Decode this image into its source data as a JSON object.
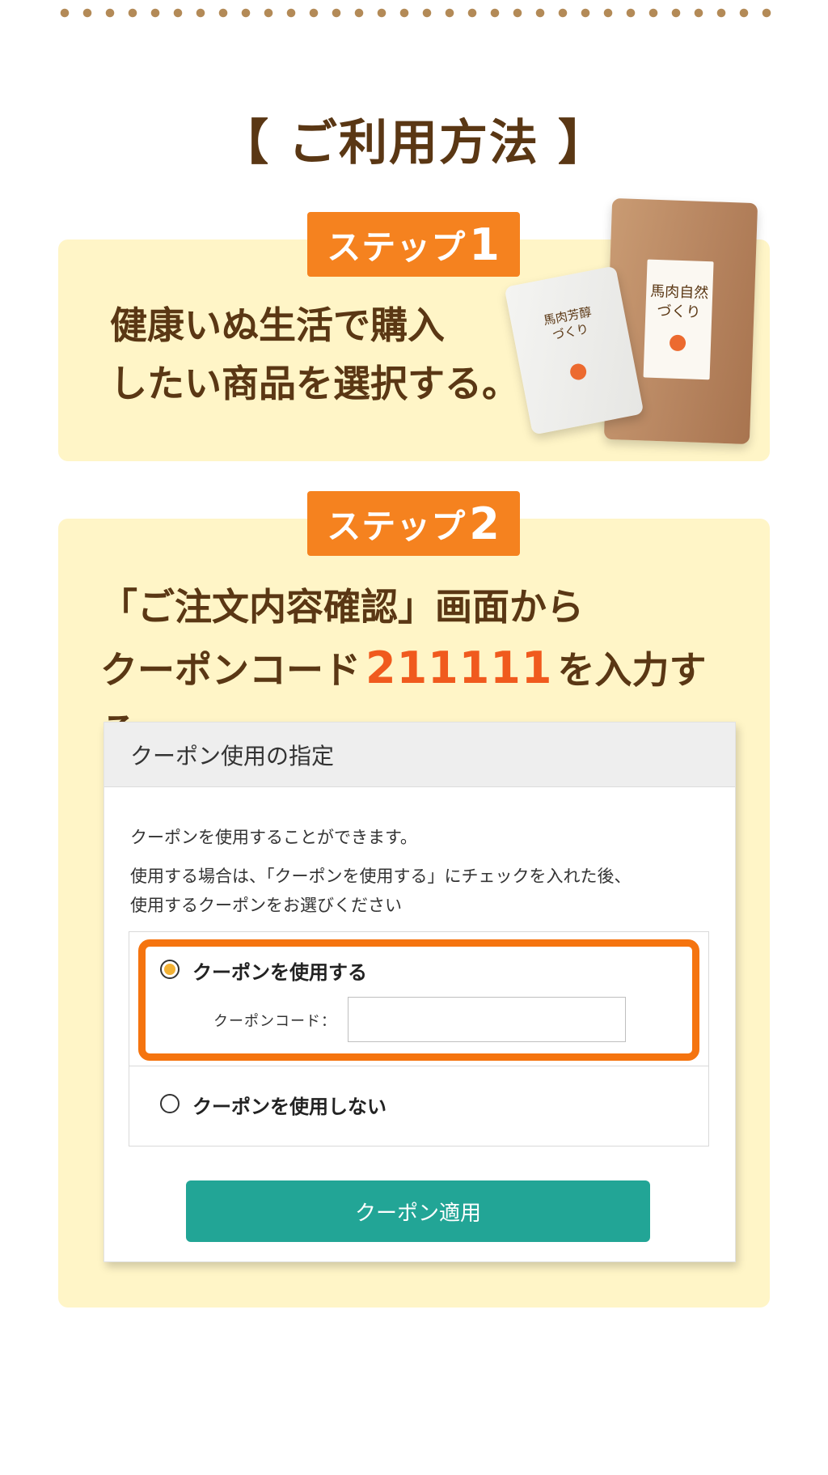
{
  "page": {
    "title": "【 ご利用方法 】"
  },
  "step1": {
    "badge_text": "ステップ",
    "badge_num": "1",
    "line1": "健康いぬ生活で購入",
    "line2": "したい商品を選択する。",
    "products": [
      {
        "title_line1": "馬肉自然",
        "title_line2": "づくり"
      },
      {
        "title_line1": "馬肉芳醇",
        "title_line2": "づくり"
      }
    ]
  },
  "step2": {
    "badge_text": "ステップ",
    "badge_num": "2",
    "line1": "「ご注文内容確認」画面から",
    "line2_before": "クーポンコード",
    "coupon_code": "211111",
    "line2_after": "を入力する。"
  },
  "coupon_panel": {
    "header": "クーポン使用の指定",
    "desc1": "クーポンを使用することができます。",
    "desc2_line1": "使用する場合は、「クーポンを使用する」にチェックを入れた後、",
    "desc2_line2": "使用するクーポンをお選びください",
    "option_use": "クーポンを使用する",
    "option_use_selected": true,
    "code_label": "クーポンコード：",
    "code_value": "",
    "option_not_use": "クーポンを使用しない",
    "apply_button": "クーポン適用"
  },
  "colors": {
    "accent_orange": "#f5821f",
    "code_red": "#f05a1e",
    "card_bg": "#fff5c7",
    "button_teal": "#22a596",
    "text_brown": "#5a3714"
  }
}
